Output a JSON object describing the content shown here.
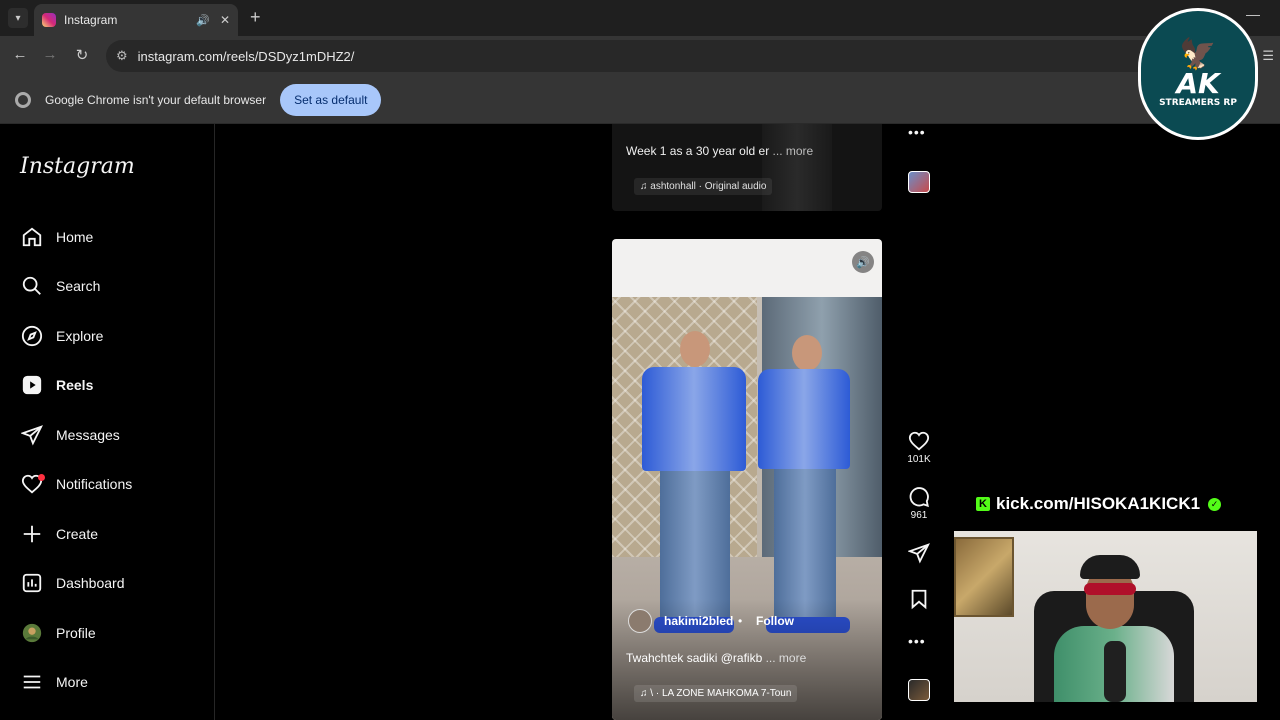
{
  "browser": {
    "tab_title": "Instagram",
    "url": "instagram.com/reels/DSDyz1mDHZ2/",
    "infobar_message": "Google Chrome isn't your default browser",
    "infobar_button": "Set as default"
  },
  "sidebar": {
    "logo": "Instagram",
    "items": [
      {
        "label": "Home",
        "icon": "home-icon"
      },
      {
        "label": "Search",
        "icon": "search-icon"
      },
      {
        "label": "Explore",
        "icon": "compass-icon"
      },
      {
        "label": "Reels",
        "icon": "reels-icon",
        "active": true
      },
      {
        "label": "Messages",
        "icon": "messages-icon"
      },
      {
        "label": "Notifications",
        "icon": "heart-icon"
      },
      {
        "label": "Create",
        "icon": "plus-icon"
      },
      {
        "label": "Dashboard",
        "icon": "dashboard-icon"
      },
      {
        "label": "Profile",
        "icon": "avatar-icon"
      },
      {
        "label": "More",
        "icon": "menu-icon"
      }
    ]
  },
  "prev_reel": {
    "caption": "Week 1 as a 30 year old er",
    "more": "... more",
    "audio": "ashtonhall · Original audio"
  },
  "reel": {
    "username": "hakimi2bled",
    "separator": "•",
    "follow": "Follow",
    "caption": "Twahchtek sadiki @rafikb",
    "more": "... more",
    "audio": "\\ · LA ZONE MAHKOMA  7-Toun",
    "likes": "101K",
    "comments": "961"
  },
  "overlay": {
    "logo_main": "AK",
    "logo_sub": "STREAMERS RP",
    "kick_text": "kick.com/HISOKA1KICK1"
  },
  "colors": {
    "accent_blue": "#a8c7fa",
    "notification_red": "#ff3040",
    "kick_green": "#53fc18"
  }
}
